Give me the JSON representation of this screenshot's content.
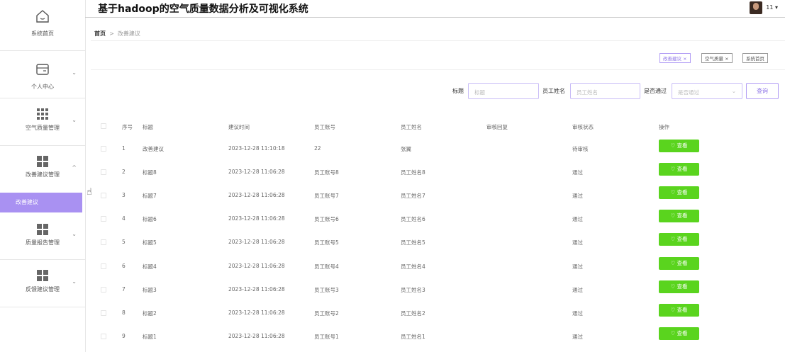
{
  "app": {
    "title": "基于hadoop的空气质量数据分析及可视化系统",
    "user": "11 ▾"
  },
  "sidebar": {
    "home": "系统首页",
    "personal": "个人中心",
    "air_quality": "空气质量管理",
    "suggestion": "改善建议管理",
    "suggestion_sub": "改善建议",
    "report": "质量报告管理",
    "feedback": "反馈建议管理"
  },
  "breadcrumb": {
    "home": "首页",
    "sep": ">",
    "current": "改善建议"
  },
  "tags": [
    "改善建议 ×",
    "空气质量 ×",
    "系统首页"
  ],
  "search": {
    "title_label": "标题",
    "title_placeholder": "标题",
    "name_label": "员工姓名",
    "name_placeholder": "员工姓名",
    "pass_label": "是否通过",
    "pass_placeholder": "是否通过",
    "button": "查询"
  },
  "table": {
    "headers": [
      "序号",
      "标题",
      "建议时间",
      "员工账号",
      "员工姓名",
      "审核回复",
      "审核状态",
      "操作"
    ],
    "view_label": "♡ 查看",
    "rows": [
      {
        "no": "1",
        "title": "改善建议",
        "time": "2023-12-28 11:10:18",
        "account": "22",
        "name": "张翼",
        "reply": "",
        "status": "待审核"
      },
      {
        "no": "2",
        "title": "标题8",
        "time": "2023-12-28 11:06:28",
        "account": "员工账号8",
        "name": "员工姓名8",
        "reply": "",
        "status": "通过"
      },
      {
        "no": "3",
        "title": "标题7",
        "time": "2023-12-28 11:06:28",
        "account": "员工账号7",
        "name": "员工姓名7",
        "reply": "",
        "status": "通过"
      },
      {
        "no": "4",
        "title": "标题6",
        "time": "2023-12-28 11:06:28",
        "account": "员工账号6",
        "name": "员工姓名6",
        "reply": "",
        "status": "通过"
      },
      {
        "no": "5",
        "title": "标题5",
        "time": "2023-12-28 11:06:28",
        "account": "员工账号5",
        "name": "员工姓名5",
        "reply": "",
        "status": "通过"
      },
      {
        "no": "6",
        "title": "标题4",
        "time": "2023-12-28 11:06:28",
        "account": "员工账号4",
        "name": "员工姓名4",
        "reply": "",
        "status": "通过"
      },
      {
        "no": "7",
        "title": "标题3",
        "time": "2023-12-28 11:06:28",
        "account": "员工账号3",
        "name": "员工姓名3",
        "reply": "",
        "status": "通过"
      },
      {
        "no": "8",
        "title": "标题2",
        "time": "2023-12-28 11:06:28",
        "account": "员工账号2",
        "name": "员工姓名2",
        "reply": "",
        "status": "通过"
      },
      {
        "no": "9",
        "title": "标题1",
        "time": "2023-12-28 11:06:28",
        "account": "员工账号1",
        "name": "员工姓名1",
        "reply": "",
        "status": "通过"
      }
    ]
  }
}
